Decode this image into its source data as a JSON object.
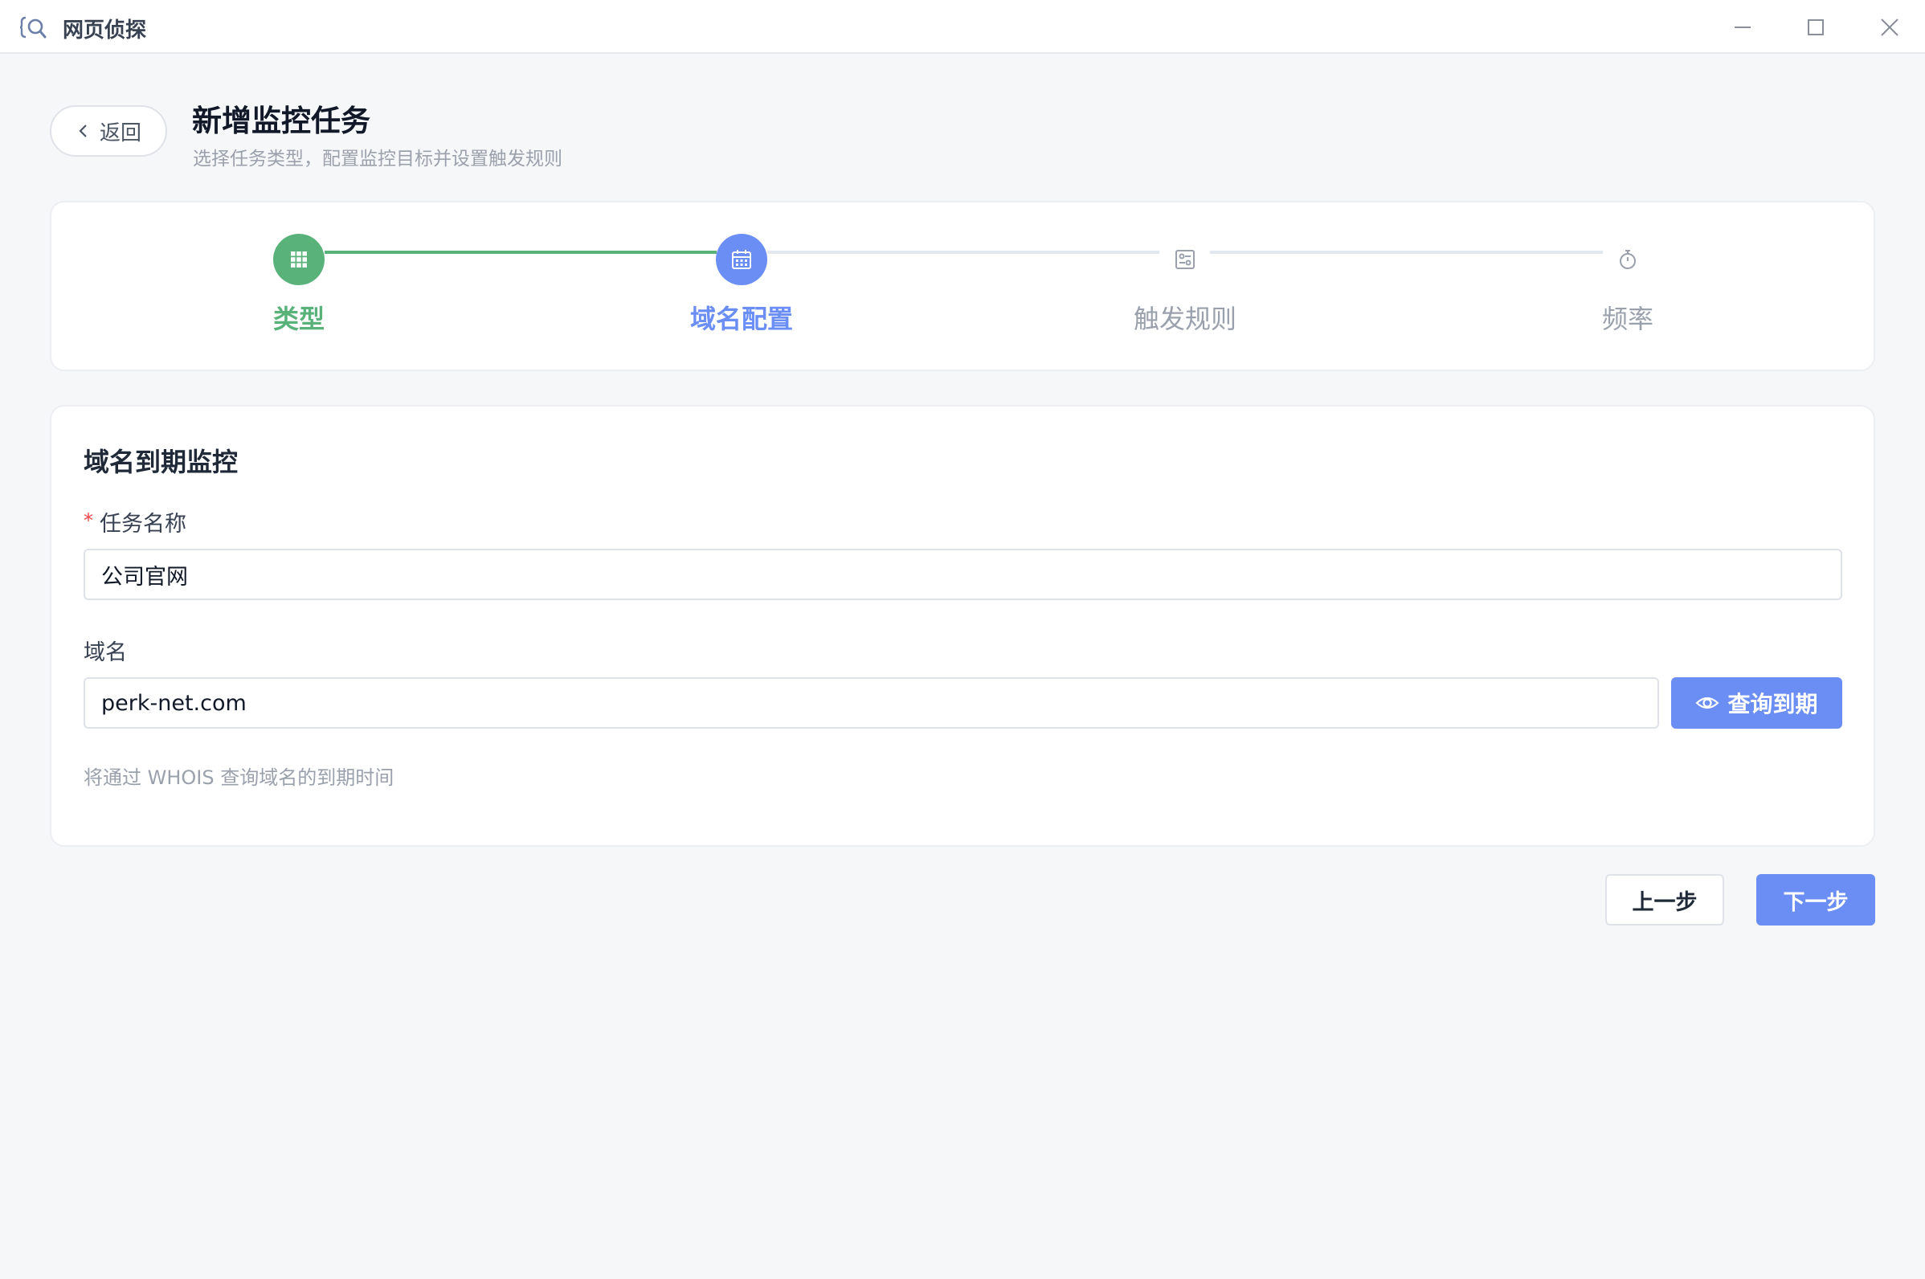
{
  "window": {
    "title": "网页侦探"
  },
  "header": {
    "back_label": "返回",
    "title": "新增监控任务",
    "subtitle": "选择任务类型，配置监控目标并设置触发规则"
  },
  "steps": [
    {
      "label": "类型",
      "status": "done"
    },
    {
      "label": "域名配置",
      "status": "active"
    },
    {
      "label": "触发规则",
      "status": "pending"
    },
    {
      "label": "频率",
      "status": "pending"
    }
  ],
  "form": {
    "section_title": "域名到期监控",
    "required_mark": "*",
    "task_name_label": "任务名称",
    "task_name_value": "公司官网",
    "domain_label": "域名",
    "domain_value": "perk-net.com",
    "query_button": "查询到期",
    "hint": "将通过 WHOIS 查询域名的到期时间"
  },
  "footer": {
    "prev_label": "上一步",
    "next_label": "下一步"
  },
  "colors": {
    "done": "#5ab27b",
    "active": "#6b8ef5",
    "pending": "#9aa1ad"
  }
}
